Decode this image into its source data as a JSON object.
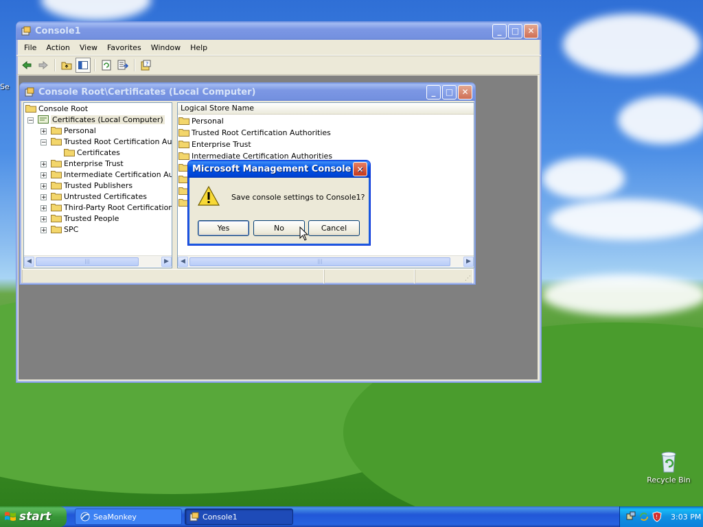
{
  "desktop": {
    "peek_text": "Se",
    "recycle_bin_label": "Recycle Bin"
  },
  "console_window": {
    "title": "Console1",
    "menu": [
      "File",
      "Action",
      "View",
      "Favorites",
      "Window",
      "Help"
    ]
  },
  "child_window": {
    "title": "Console Root\\Certificates (Local Computer)",
    "tree": {
      "root": "Console Root",
      "certificates": "Certificates (Local Computer)",
      "personal": "Personal",
      "trusted_root": "Trusted Root Certification Author",
      "certs_sub": "Certificates",
      "enterprise": "Enterprise Trust",
      "intermediate": "Intermediate Certification Author",
      "trusted_publishers": "Trusted Publishers",
      "untrusted": "Untrusted Certificates",
      "third_party": "Third-Party Root Certification Au",
      "trusted_people": "Trusted People",
      "spc": "SPC"
    },
    "list": {
      "column_header": "Logical Store Name",
      "items": [
        "Personal",
        "Trusted Root Certification Authorities",
        "Enterprise Trust",
        "Intermediate Certification Authorities"
      ]
    }
  },
  "dialog": {
    "title": "Microsoft Management Console",
    "message": "Save console settings to Console1?",
    "yes_label": "Yes",
    "no_label": "No",
    "cancel_label": "Cancel"
  },
  "taskbar": {
    "start_label": "start",
    "tasks": [
      "SeaMonkey",
      "Console1"
    ],
    "clock": "3:03 PM"
  },
  "colors": {
    "xp_title_blue": "#0055e5",
    "dialog_face": "#ece9d8",
    "taskbar_blue": "#2157d7",
    "start_green": "#379637",
    "close_red": "#c4381c"
  }
}
